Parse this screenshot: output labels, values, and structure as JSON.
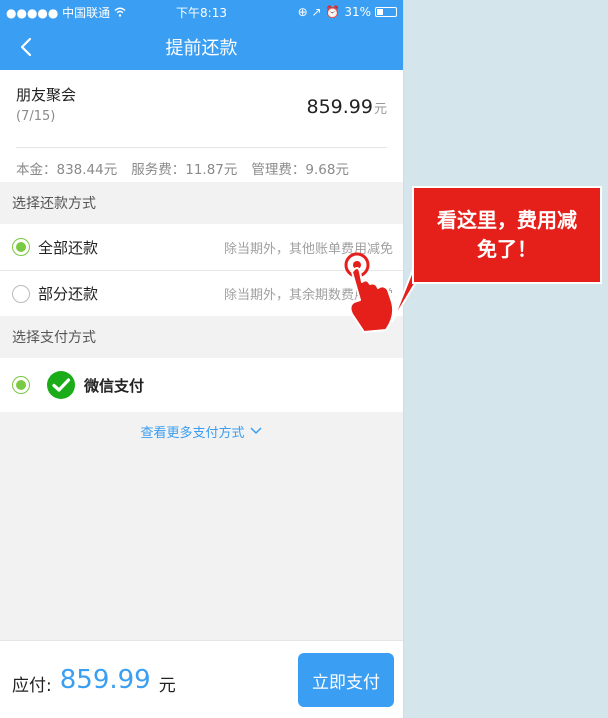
{
  "status_bar": {
    "carrier": "●●●●● 中国联通",
    "wifi_icon": "wifi-icon",
    "time": "下午8:13",
    "right_icons": "⊕ ↗ ⏰",
    "battery": "31%"
  },
  "header": {
    "title": "提前还款",
    "back_icon": "chevron-left-icon"
  },
  "bill": {
    "name": "朋友聚会",
    "period": "(7/15)",
    "amount": "859.99",
    "amount_unit": "元",
    "principal": "本金：838.44元",
    "service_fee": "服务费：11.87元",
    "management_fee": "管理费：9.68元"
  },
  "repay_section": {
    "title": "选择还款方式",
    "options": [
      {
        "label": "全部还款",
        "desc": "除当期外，其他账单费用减免",
        "selected": true
      },
      {
        "label": "部分还款",
        "desc": "除当期外，其余期数费用照常",
        "selected": false
      }
    ]
  },
  "pay_section": {
    "title": "选择支付方式",
    "method": {
      "label": "微信支付",
      "icon": "wechat-icon",
      "selected": true
    },
    "more": "查看更多支付方式"
  },
  "footer": {
    "due_label": "应付:",
    "due_amount": "859.99",
    "due_unit": "元",
    "pay_button": "立即支付"
  },
  "callout": {
    "text": "看这里，费用减免了！"
  },
  "colors": {
    "primary": "#3a9ef2",
    "selected": "#7ac943",
    "callout": "#e5201b"
  }
}
